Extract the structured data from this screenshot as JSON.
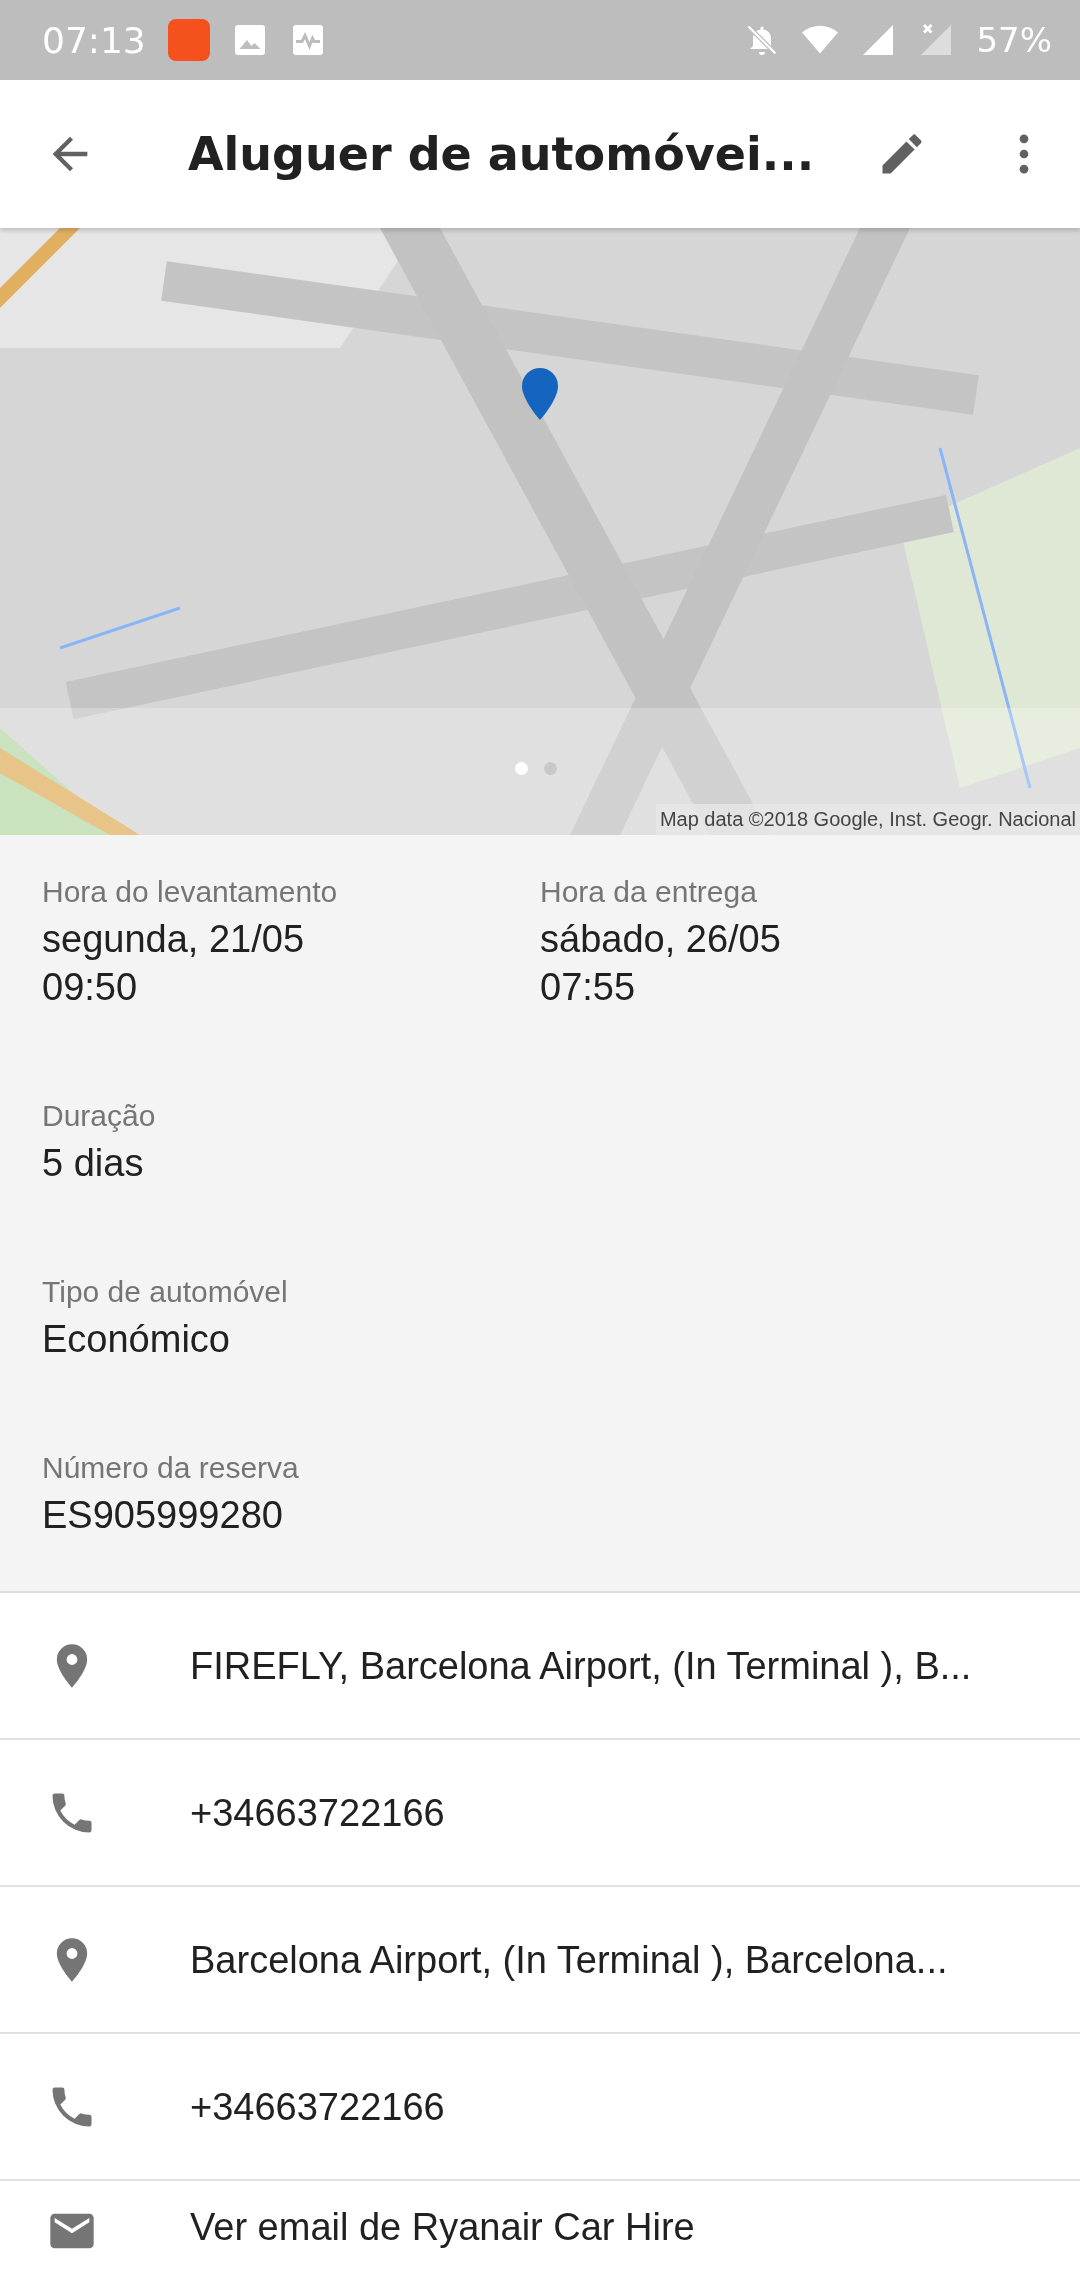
{
  "status_bar": {
    "time": "07:13",
    "battery": "57%"
  },
  "app_bar": {
    "title": "Aluguer de automóvei..."
  },
  "map": {
    "attribution": "Map data ©2018 Google, Inst. Geogr. Nacional",
    "pages": [
      {
        "selected": true
      },
      {
        "selected": false
      }
    ]
  },
  "details": [
    {
      "label": "Hora do levantamento",
      "value": "segunda, 21/05\n09:50"
    },
    {
      "label": "Hora da entrega",
      "value": "sábado, 26/05\n07:55"
    },
    {
      "label": "Duração",
      "value": "5 dias"
    },
    {
      "label": "Tipo de automóvel",
      "value": "Económico"
    },
    {
      "label": "Número da reserva",
      "value": "ES905999280"
    }
  ],
  "contacts": [
    {
      "kind": "place",
      "text": "FIREFLY, Barcelona Airport, (In Terminal ), B..."
    },
    {
      "kind": "phone",
      "text": "+34663722166"
    },
    {
      "kind": "place",
      "text": "Barcelona Airport, (In Terminal ), Barcelona..."
    },
    {
      "kind": "phone",
      "text": "+34663722166"
    },
    {
      "kind": "email",
      "text": "Ver email de Ryanair Car Hire"
    }
  ]
}
